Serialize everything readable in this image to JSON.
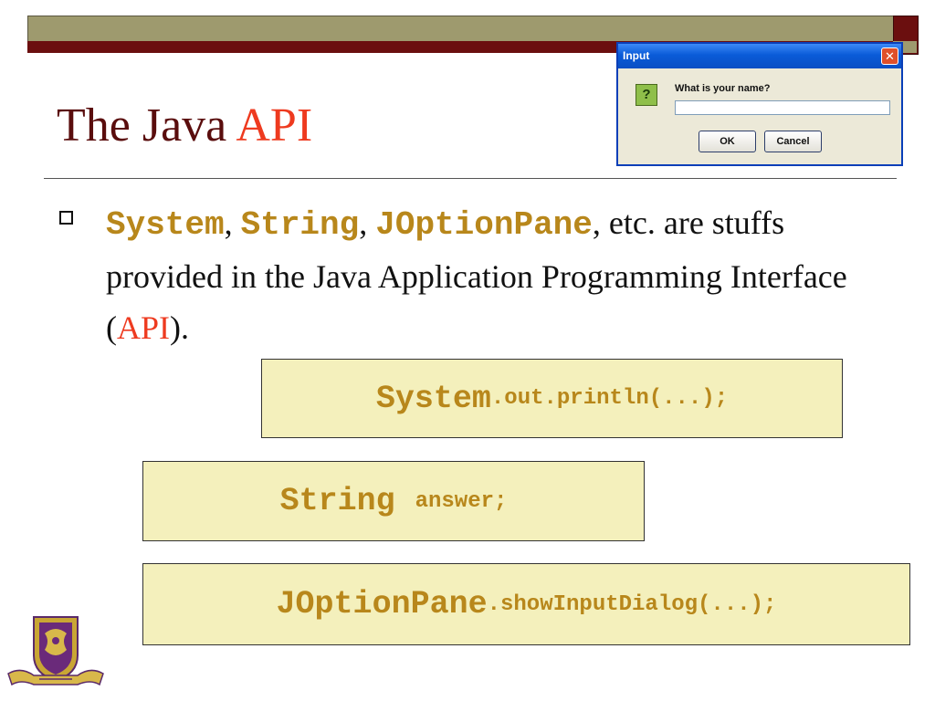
{
  "slide": {
    "title_plain": "The Java ",
    "title_accent": "API",
    "bullet": {
      "code1": "System",
      "sep1": ", ",
      "code2": "String",
      "sep2": ", ",
      "code3": "JOptionPane",
      "after_codes": ", etc. are stuffs provided in the Java Application Programming Interface (",
      "api": "API",
      "close": ")."
    }
  },
  "code_boxes": [
    {
      "class_name": "System",
      "rest": ".out.println(...);"
    },
    {
      "class_name": "String",
      "rest": "answer;"
    },
    {
      "class_name": "JOptionPane",
      "rest": ".showInputDialog(...);"
    }
  ],
  "dialog": {
    "title": "Input",
    "close_glyph": "✕",
    "question_glyph": "?",
    "prompt": "What is your name?",
    "input_value": "",
    "ok_label": "OK",
    "cancel_label": "Cancel"
  },
  "logo": {
    "name": "university-crest-logo"
  },
  "colors": {
    "title": "#5a0d0d",
    "accent": "#ee3a1f",
    "code": "#b8871b",
    "box_fill": "#f4f0bc",
    "band_olive": "#9e9a6e",
    "band_maroon": "#6b0f0f"
  }
}
